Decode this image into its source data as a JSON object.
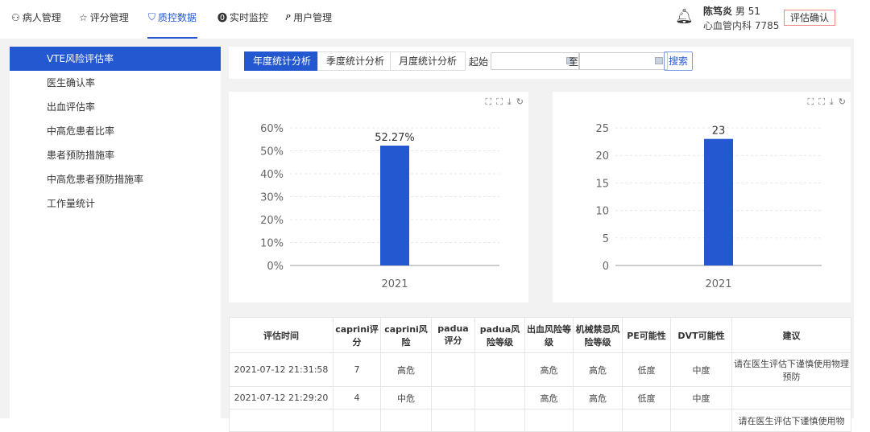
{
  "nav": {
    "items": [
      {
        "label": "病人管理",
        "icon": "user-group-icon"
      },
      {
        "label": "评分管理",
        "icon": "star-icon"
      },
      {
        "label": "质控数据",
        "icon": "shield-icon",
        "active": true
      },
      {
        "label": "实时监控",
        "icon": "monitor-icon"
      },
      {
        "label": "用户管理",
        "icon": "user-icon"
      }
    ]
  },
  "user": {
    "name": "陈笃炎",
    "info": "男 51",
    "dept": "心血管内科 7785",
    "confirm_label": "评估确认"
  },
  "sidebar": {
    "items": [
      {
        "label": "VTE风险评估率",
        "active": true
      },
      {
        "label": "医生确认率"
      },
      {
        "label": "出血评估率"
      },
      {
        "label": "中高危患者比率"
      },
      {
        "label": "患者预防措施率"
      },
      {
        "label": "中高危患者预防措施率"
      },
      {
        "label": "工作量统计"
      }
    ]
  },
  "toolbar": {
    "tabs": [
      "年度统计分析",
      "季度统计分析",
      "月度统计分析"
    ],
    "start_label": "起始",
    "start_value": "",
    "to_label": "至",
    "end_value": "",
    "search_label": "搜索"
  },
  "chart_data": [
    {
      "type": "bar",
      "categories": [
        "2021"
      ],
      "values": [
        52.27
      ],
      "data_labels": [
        "52.27%"
      ],
      "ylim": [
        0,
        60
      ],
      "yticks": [
        "0%",
        "10%",
        "20%",
        "30%",
        "40%",
        "50%",
        "60%"
      ],
      "color": "#2458d0",
      "grid": true
    },
    {
      "type": "bar",
      "categories": [
        "2021"
      ],
      "values": [
        23
      ],
      "data_labels": [
        "23"
      ],
      "ylim": [
        0,
        25
      ],
      "yticks": [
        "0",
        "5",
        "10",
        "15",
        "20",
        "25"
      ],
      "color": "#2458d0",
      "grid": true
    }
  ],
  "table": {
    "headers": [
      "评估时间",
      "caprini评分",
      "caprini风险",
      "padua评分",
      "padua风险等级",
      "出血风险等级",
      "机械禁忌风险等级",
      "PE可能性",
      "DVT可能性",
      "建议"
    ],
    "rows": [
      [
        "2021-07-12 21:31:58",
        "7",
        "高危",
        "",
        "",
        "高危",
        "高危",
        "低度",
        "中度",
        "请在医生评估下谨慎使用物理预防"
      ],
      [
        "2021-07-12 21:29:20",
        "4",
        "中危",
        "",
        "",
        "高危",
        "高危",
        "低度",
        "中度",
        ""
      ],
      [
        "",
        "",
        "",
        "",
        "",
        "",
        "",
        "",
        "",
        "请在医生评估下谨慎使用物"
      ]
    ]
  }
}
